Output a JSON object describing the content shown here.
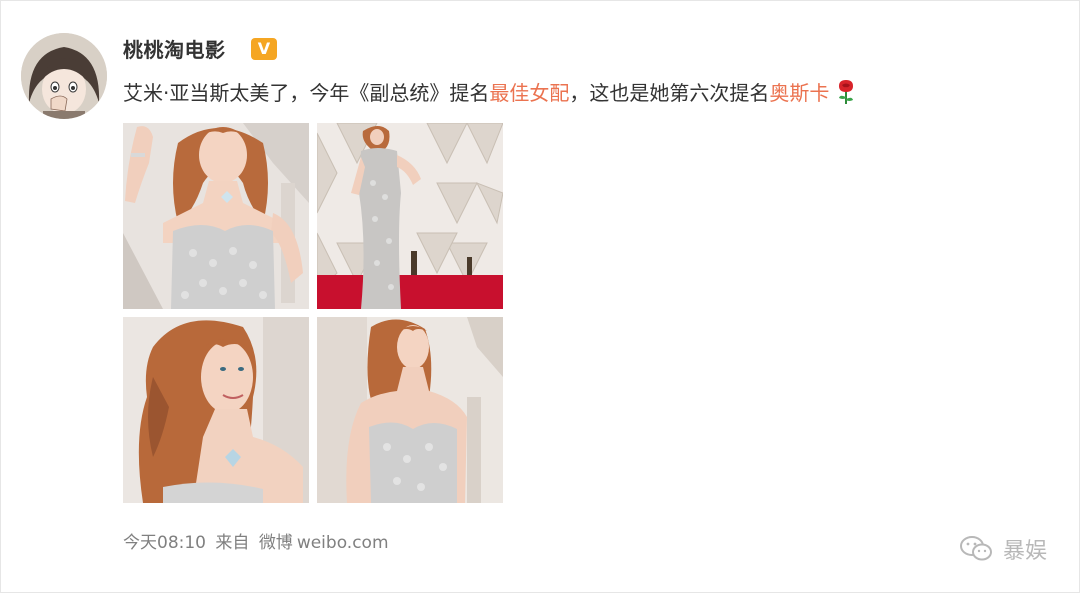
{
  "post": {
    "username": "桃桃淘电影",
    "verified_badge": "V",
    "text_parts": {
      "p1": "艾米·亚当斯太美了，今年《副总统》提名",
      "p2": "最佳女配",
      "p3": "，这也是她第六次提名",
      "p4": "奥斯卡"
    },
    "emoji": "rose-icon",
    "highlight_color": "#eb7350",
    "footer": {
      "time": "今天08:10",
      "from_label": "来自",
      "source_app": "微博",
      "source_domain": "weibo.com"
    }
  },
  "images": [
    {
      "name": "photo-1"
    },
    {
      "name": "photo-2"
    },
    {
      "name": "photo-3"
    },
    {
      "name": "photo-4"
    }
  ],
  "watermark": {
    "text": "暴娱"
  },
  "colors": {
    "text": "#333333",
    "meta": "#808080",
    "badge": "#f5a623",
    "red_carpet": "#c8102e"
  }
}
